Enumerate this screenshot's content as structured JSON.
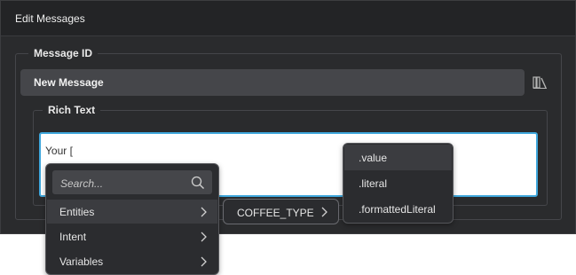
{
  "dialog": {
    "title": "Edit Messages"
  },
  "message_id": {
    "legend": "Message ID",
    "value": "New Message",
    "library_icon": "library-books-icon"
  },
  "rich_text": {
    "legend": "Rich Text",
    "content": "Your ["
  },
  "insert_menu": {
    "search_placeholder": "Search...",
    "search_icon": "search-icon",
    "items": [
      {
        "label": "Entities",
        "icon": "chevron-right-icon"
      },
      {
        "label": "Intent",
        "icon": "chevron-right-icon"
      },
      {
        "label": "Variables",
        "icon": "chevron-right-icon"
      }
    ]
  },
  "entity_submenu": {
    "label": "COFFEE_TYPE",
    "icon": "chevron-right-icon"
  },
  "property_menu": {
    "items": [
      {
        "label": ".value"
      },
      {
        "label": ".literal"
      },
      {
        "label": ".formattedLiteral"
      }
    ]
  },
  "colors": {
    "dialog_bg": "#2a2b2d",
    "header_bg": "#232426",
    "input_bg": "#45464a",
    "focus_border": "#3fa7dc",
    "popup_bg": "#2b2c2f",
    "hover_bg": "#3b3c40"
  }
}
